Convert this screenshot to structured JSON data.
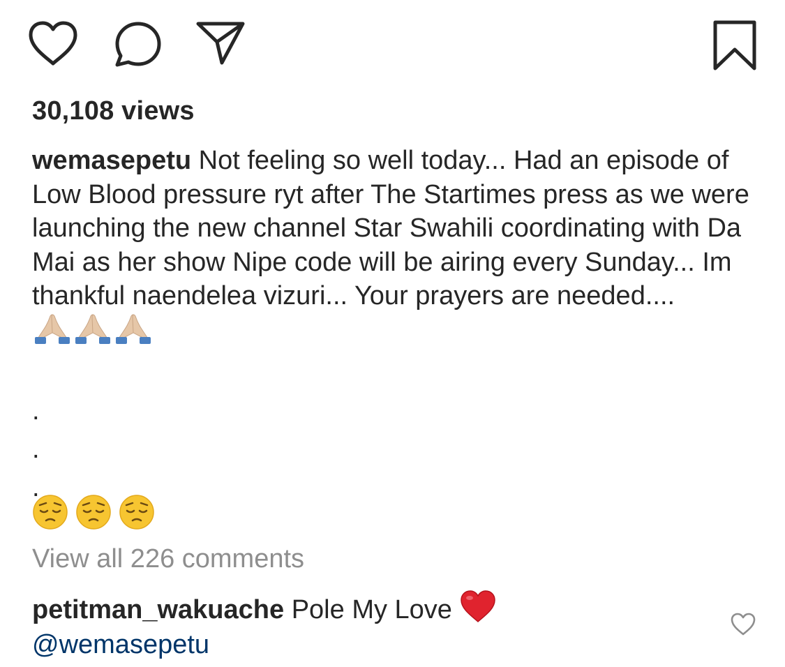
{
  "post": {
    "views": "30,108 views",
    "caption_user": "wemasepetu",
    "caption_text": "Not feeling so well today... Had an episode of Low Blood pressure ryt after The Startimes press as we were launching the new channel Star Swahili coordinating with Da Mai as her show Nipe code will be airing every Sunday... Im thankful naendelea vizuri... Your prayers are needed....",
    "caption_dots": [
      ".",
      ".",
      "."
    ],
    "view_comments": "View all 226 comments"
  },
  "comment": {
    "user": "petitman_wakuache",
    "text": "Pole My Love",
    "mention": "@wemasepetu"
  },
  "icons": {
    "like": "heart-outline-icon",
    "comment": "speech-bubble-icon",
    "share": "paper-plane-icon",
    "save": "bookmark-icon",
    "comment_like": "small-heart-outline-icon",
    "red_heart": "red-heart-emoji",
    "pray": "folded-hands-emoji",
    "pensive": "pensive-face-emoji"
  },
  "colors": {
    "text": "#262626",
    "muted": "#8e8e8e",
    "mention": "#003569",
    "heart_red": "#e0232e"
  }
}
